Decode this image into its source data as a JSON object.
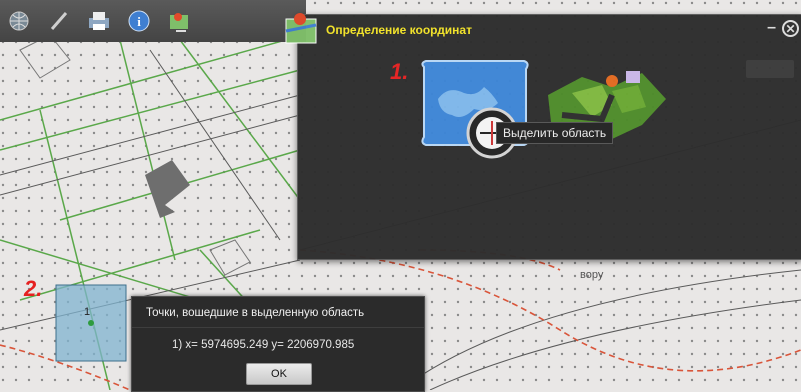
{
  "toolbar": {
    "icons": [
      "globe-icon",
      "pencil-icon",
      "printer-icon",
      "info-icon",
      "map-pin-icon"
    ]
  },
  "panel": {
    "title": "Определение координат",
    "minimize_label": "–",
    "close_label": "✕"
  },
  "steps": {
    "one": "1.",
    "two": "2."
  },
  "tooltip": "Выделить область",
  "selection": {
    "label": "1"
  },
  "dialog": {
    "title": "Точки, вошедшие в выделенную область",
    "coords": "1) x= 5974695.249   y= 2206970.985",
    "ok_label": "OK"
  },
  "map_label": "вору",
  "colors": {
    "background": "#e9e7e6",
    "green_lines": "#5aa84a",
    "red_dashed": "#d9553a",
    "panel": "#2d2d2d",
    "title_yellow": "#f2e226",
    "step_red": "#e52020",
    "selection_fill": "#7fb3cf"
  }
}
